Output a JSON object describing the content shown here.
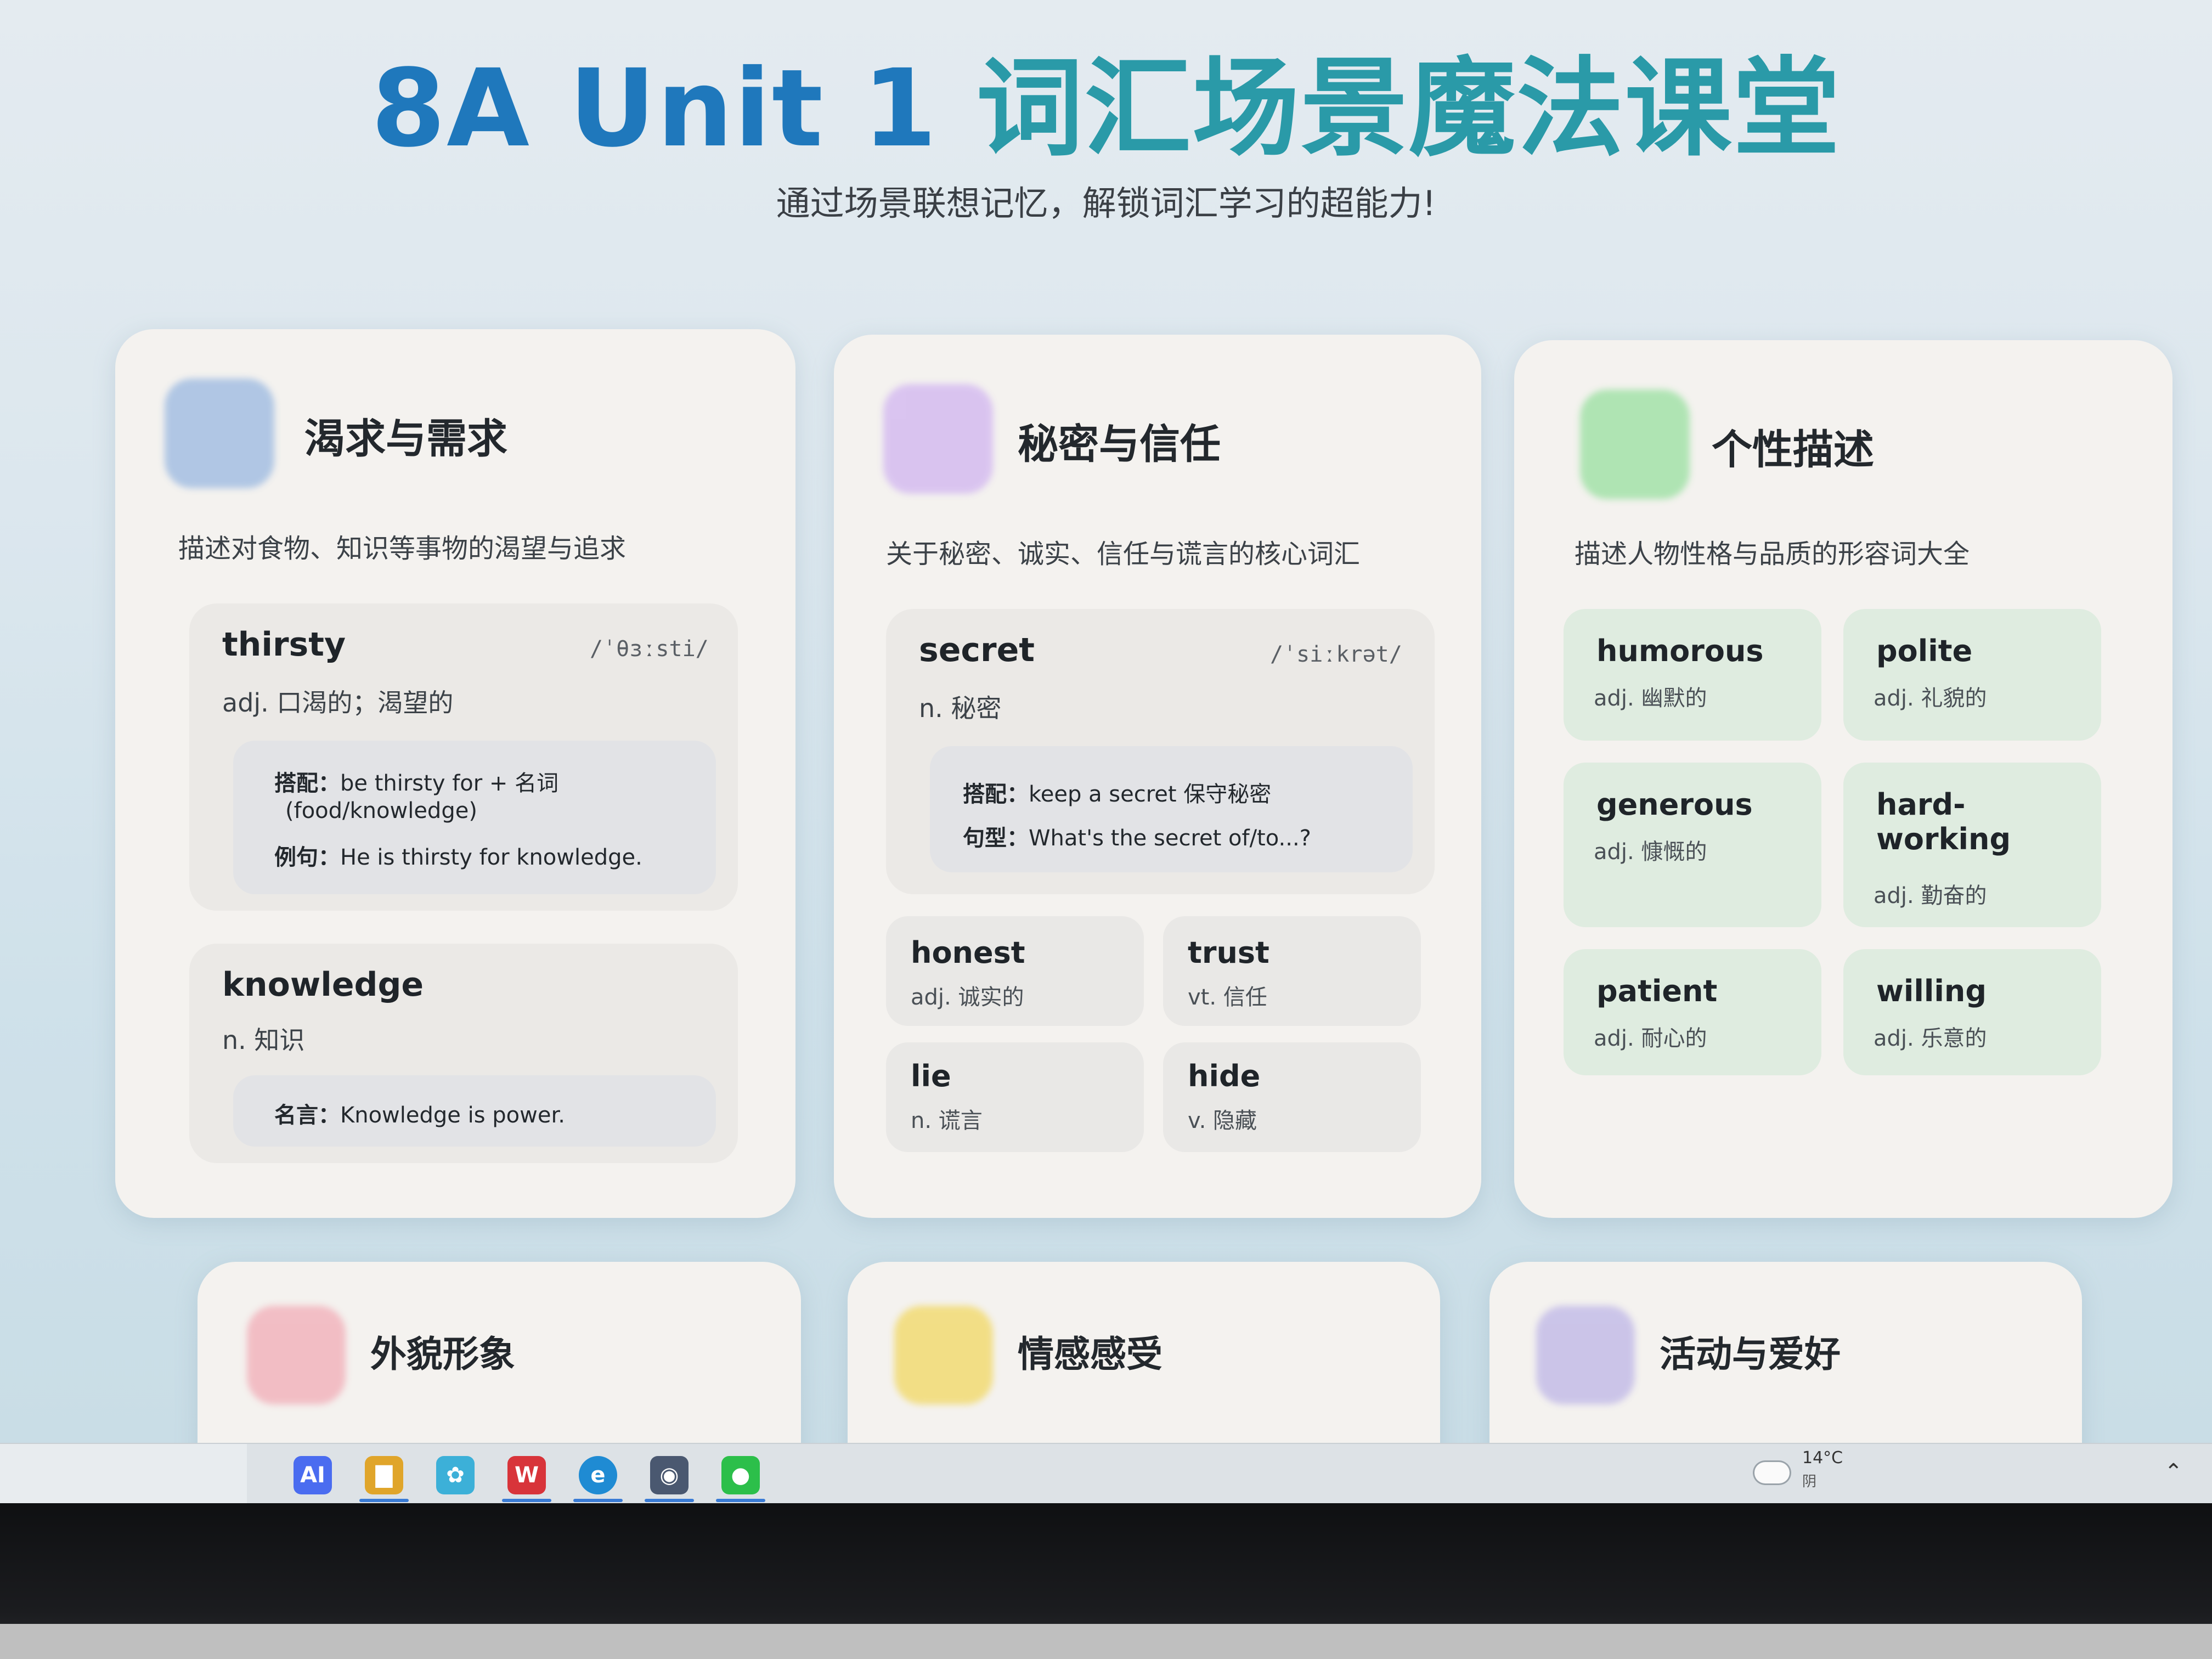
{
  "header": {
    "title_en": "8A Unit 1 ",
    "title_cn": "词汇场景魔法课堂",
    "subtitle": "通过场景联想记忆，解锁词汇学习的超能力!"
  },
  "cards": {
    "desire": {
      "title": "渴求与需求",
      "desc": "描述对食物、知识等事物的渴望与追求",
      "icon_color": "#a9c2e3",
      "w1": {
        "word": "thirsty",
        "phon": "/ˈθɜːsti/",
        "mean": "adj. 口渴的；渴望的",
        "l1_label": "搭配：",
        "l1_text": "be thirsty for + 名词",
        "l1_text2": "(food/knowledge)",
        "l2_label": "例句：",
        "l2_text": "He is thirsty for knowledge."
      },
      "w2": {
        "word": "knowledge",
        "mean": "n. 知识",
        "l1_label": "名言：",
        "l1_text": "Knowledge is power."
      }
    },
    "secret": {
      "title": "秘密与信任",
      "desc": "关于秘密、诚实、信任与谎言的核心词汇",
      "icon_color": "#d7bff0",
      "w1": {
        "word": "secret",
        "phon": "/ˈsiːkrət/",
        "mean": "n. 秘密",
        "l1_label": "搭配：",
        "l1_text": "keep a secret 保守秘密",
        "l2_label": "句型：",
        "l2_text": "What's the secret of/to...?"
      },
      "minis": [
        {
          "word": "honest",
          "mean": "adj. 诚实的"
        },
        {
          "word": "trust",
          "mean": "vt. 信任"
        },
        {
          "word": "lie",
          "mean": "n. 谎言"
        },
        {
          "word": "hide",
          "mean": "v. 隐藏"
        }
      ]
    },
    "personality": {
      "title": "个性描述",
      "desc": "描述人物性格与品质的形容词大全",
      "icon_color": "#a8e3ad",
      "minis": [
        {
          "word": "humorous",
          "mean": "adj. 幽默的"
        },
        {
          "word": "polite",
          "mean": "adj. 礼貌的"
        },
        {
          "word": "generous",
          "mean": "adj. 慷慨的"
        },
        {
          "word": "hard-",
          "word2": "working",
          "mean": "adj. 勤奋的"
        },
        {
          "word": "patient",
          "mean": "adj. 耐心的"
        },
        {
          "word": "willing",
          "mean": "adj. 乐意的"
        }
      ]
    },
    "appearance": {
      "title": "外貌形象",
      "icon_color": "#f2b8c0"
    },
    "emotion": {
      "title": "情感感受",
      "icon_color": "#f2dc7a"
    },
    "hobby": {
      "title": "活动与爱好",
      "icon_color": "#c7c0e8"
    }
  },
  "taskbar": {
    "apps": [
      {
        "name": "AI",
        "label": "AI",
        "color": "#4a6cf0"
      },
      {
        "name": "files",
        "label": "▇",
        "color": "#e0a52a"
      },
      {
        "name": "gallery",
        "label": "✿",
        "color": "#3cb0d8"
      },
      {
        "name": "wps",
        "label": "W",
        "color": "#d8343a"
      },
      {
        "name": "edge",
        "label": "e",
        "color": "#1f8bd3"
      },
      {
        "name": "camera",
        "label": "◉",
        "color": "#4a5870"
      },
      {
        "name": "wechat",
        "label": "●",
        "color": "#2cbf4a"
      }
    ],
    "weather_temp": "14°C",
    "weather_desc": "阴"
  }
}
